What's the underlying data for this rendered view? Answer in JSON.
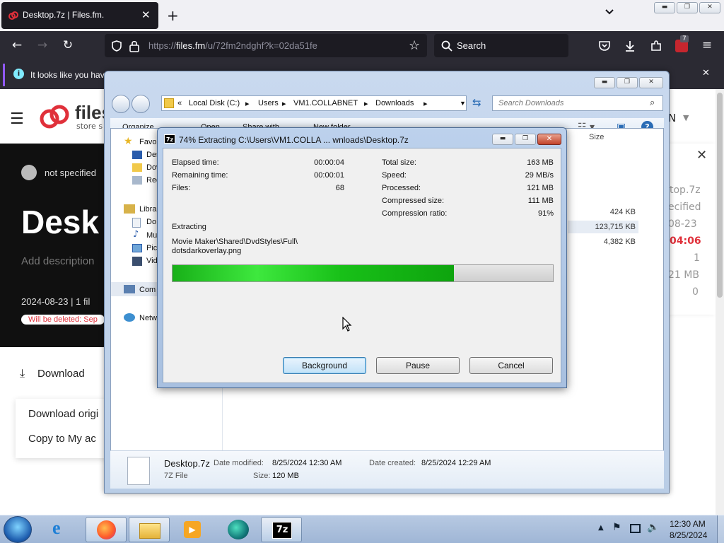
{
  "browser": {
    "tab_title": "Desktop.7z | Files.fm.",
    "url_prefix": "https://",
    "url_host": "files.fm",
    "url_path": "/u/72fm2ndghf?k=02da51fe",
    "search_placeholder": "Search",
    "extensions_badge": "7",
    "notification": "It looks like you hav"
  },
  "page": {
    "logo_text": "files",
    "logo_sub": "store s",
    "owner": "not specified",
    "title": "Desk",
    "description_placeholder": "Add description",
    "meta": "2024-08-23 | 1 fil",
    "deletion_notice": "Will be deleted: Sep",
    "download_label": "Download",
    "menu_download_original": "Download origi",
    "menu_copy": "Copy to My ac",
    "lang_fragment": "N",
    "right_panel": [
      "top.7z",
      "ecified",
      "08-23",
      "04:06",
      "1",
      "21 MB",
      "0"
    ]
  },
  "explorer": {
    "breadcrumb": [
      "«",
      "Local Disk (C:)",
      "Users",
      "VM1.COLLABNET",
      "Downloads"
    ],
    "search_placeholder": "Search Downloads",
    "toolbar": {
      "organize": "Organize",
      "open": "Open",
      "share": "Share with",
      "new_folder": "New folder"
    },
    "column_size": "Size",
    "nav": [
      {
        "label": "Favo",
        "icon": "star-icon"
      },
      {
        "label": "Des",
        "icon": "desktop-icon"
      },
      {
        "label": "Dov",
        "icon": "folder-icon"
      },
      {
        "label": "Rec",
        "icon": "recent-icon"
      },
      {
        "label": "Libra",
        "icon": "library-icon"
      },
      {
        "label": "Do",
        "icon": "documents-icon"
      },
      {
        "label": "Mu",
        "icon": "music-icon"
      },
      {
        "label": "Pic",
        "icon": "pictures-icon"
      },
      {
        "label": "Vid",
        "icon": "videos-icon"
      },
      {
        "label": "Com",
        "icon": "computer-icon"
      },
      {
        "label": "Netw",
        "icon": "network-icon"
      }
    ],
    "sizes": [
      "424 KB",
      "123,715 KB",
      "4,382 KB"
    ],
    "details": {
      "name": "Desktop.7z",
      "type": "7Z File",
      "modified_label": "Date modified:",
      "modified": "8/25/2024 12:30 AM",
      "created_label": "Date created:",
      "created": "8/25/2024 12:29 AM",
      "size_label": "Size:",
      "size": "120 MB"
    }
  },
  "dialog": {
    "title": "74% Extracting C:\\Users\\VM1.COLLA ... wnloads\\Desktop.7z",
    "progress": 0.74,
    "left_stats": [
      {
        "label": "Elapsed time:",
        "value": "00:00:04"
      },
      {
        "label": "Remaining time:",
        "value": "00:00:01"
      },
      {
        "label": "Files:",
        "value": "68"
      }
    ],
    "right_stats": [
      {
        "label": "Total size:",
        "value": "163 MB"
      },
      {
        "label": "Speed:",
        "value": "29 MB/s"
      },
      {
        "label": "Processed:",
        "value": "121 MB"
      },
      {
        "label": "Compressed size:",
        "value": "111 MB"
      },
      {
        "label": "Compression ratio:",
        "value": "91%"
      }
    ],
    "action": "Extracting",
    "current_path": "Movie Maker\\Shared\\DvdStyles\\Full\\",
    "current_file": "dotsdarkoverlay.png",
    "buttons": {
      "background": "Background",
      "pause": "Pause",
      "cancel": "Cancel"
    }
  },
  "taskbar": {
    "time": "12:30 AM",
    "date": "8/25/2024"
  }
}
